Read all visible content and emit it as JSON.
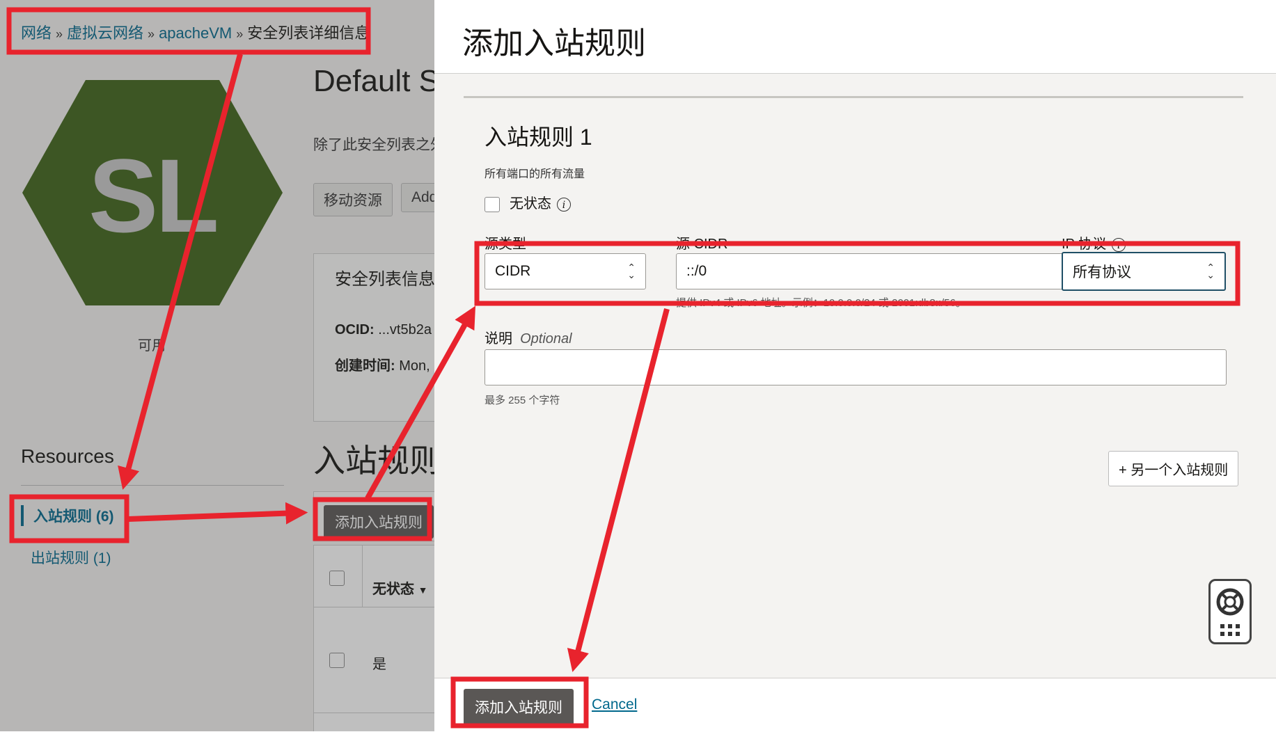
{
  "breadcrumb": {
    "items": [
      "网络",
      "虚拟云网络",
      "apacheVM"
    ],
    "current": "安全列表详细信息",
    "separator": "»"
  },
  "resource_icon": {
    "letters": "SL",
    "color": "#3e6318",
    "status": "可用"
  },
  "page": {
    "title": "Default S",
    "description": "除了此安全列表之外",
    "buttons": [
      "移动资源",
      "Add"
    ]
  },
  "info_card": {
    "title": "安全列表信息",
    "ocid_label": "OCID:",
    "ocid_value": "...vt5b2a",
    "created_label": "创建时间:",
    "created_value": "Mon,"
  },
  "ingress_section": {
    "title": "入站规则",
    "add_button": "添加入站规则",
    "column_stateless": "无状态",
    "row_value": "是"
  },
  "resources": {
    "title": "Resources",
    "items": [
      {
        "label": "入站规则 (6)",
        "active": true
      },
      {
        "label": "出站规则 (1)",
        "active": false
      }
    ]
  },
  "panel": {
    "title": "添加入站规则",
    "rule_title": "入站规则 1",
    "rule_subtitle": "所有端口的所有流量",
    "stateless_label": "无状态",
    "source_type_label": "源类型",
    "source_type_value": "CIDR",
    "source_cidr_label": "源 CIDR",
    "source_cidr_value": "::/0",
    "cidr_hint": "提供 IPv4 或 IPv6 地址。示例：10.0.0.0/24 或 2001:db8::/56。",
    "ip_protocol_label": "IP 协议",
    "ip_protocol_value": "所有协议",
    "description_label": "说明",
    "description_optional": "Optional",
    "description_hint": "最多 255 个字符",
    "another_rule_button": "+ 另一个入站规则",
    "submit_button": "添加入站规则",
    "cancel_link": "Cancel"
  },
  "annotation_color": "#e8232d"
}
